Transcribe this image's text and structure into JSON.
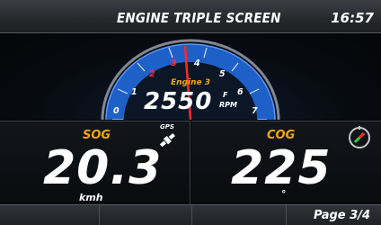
{
  "header": {
    "title": "ENGINE TRIPLE SCREEN",
    "time": "16:57"
  },
  "rpm_gauge": {
    "engine_label": "Engine 3",
    "value": "2550",
    "unit_top": "F",
    "unit_bottom": "RPM",
    "scale": [
      "0",
      "1",
      "2",
      "3",
      "4",
      "5",
      "6",
      "7"
    ],
    "level_fraction": 0.364,
    "colors": {
      "arc_fill": "#1f5fc8",
      "needle": "#ff2a2a",
      "accent": "#f2a515"
    }
  },
  "sog": {
    "label": "SOG",
    "value": "20.3",
    "unit": "kmh",
    "gps_label": "GPS"
  },
  "cog": {
    "label": "COG",
    "value": "225",
    "unit": "°"
  },
  "footer": {
    "page": "Page 3/4"
  }
}
